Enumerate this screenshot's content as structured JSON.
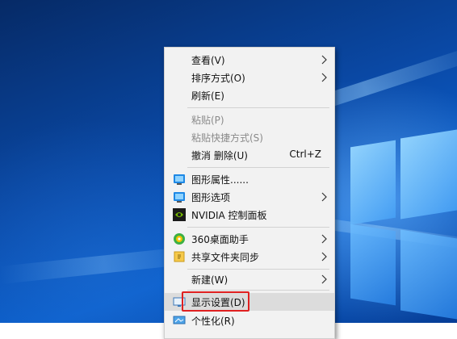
{
  "context_menu": {
    "items": [
      {
        "label": "查看(V)",
        "submenu": true
      },
      {
        "label": "排序方式(O)",
        "submenu": true
      },
      {
        "label": "刷新(E)"
      },
      {
        "label": "粘贴(P)",
        "disabled": true
      },
      {
        "label": "粘贴快捷方式(S)",
        "disabled": true
      },
      {
        "label": "撤消 删除(U)",
        "shortcut": "Ctrl+Z"
      },
      {
        "label": "图形属性......",
        "icon": "graphics-properties-icon"
      },
      {
        "label": "图形选项",
        "icon": "graphics-options-icon",
        "submenu": true
      },
      {
        "label": "NVIDIA 控制面板",
        "icon": "nvidia-icon"
      },
      {
        "label": "360桌面助手",
        "icon": "360-desktop-icon",
        "submenu": true
      },
      {
        "label": "共享文件夹同步",
        "icon": "folder-sync-icon",
        "submenu": true
      },
      {
        "label": "新建(W)",
        "submenu": true
      },
      {
        "label": "显示设置(D)",
        "icon": "display-settings-icon",
        "highlighted": true
      },
      {
        "label": "个性化(R)",
        "icon": "personalize-icon"
      }
    ]
  },
  "colors": {
    "desktop": "#0b4fae",
    "menu_bg": "#f2f2f2",
    "highlight_box": "#e02020",
    "nvidia_green": "#76b900"
  }
}
